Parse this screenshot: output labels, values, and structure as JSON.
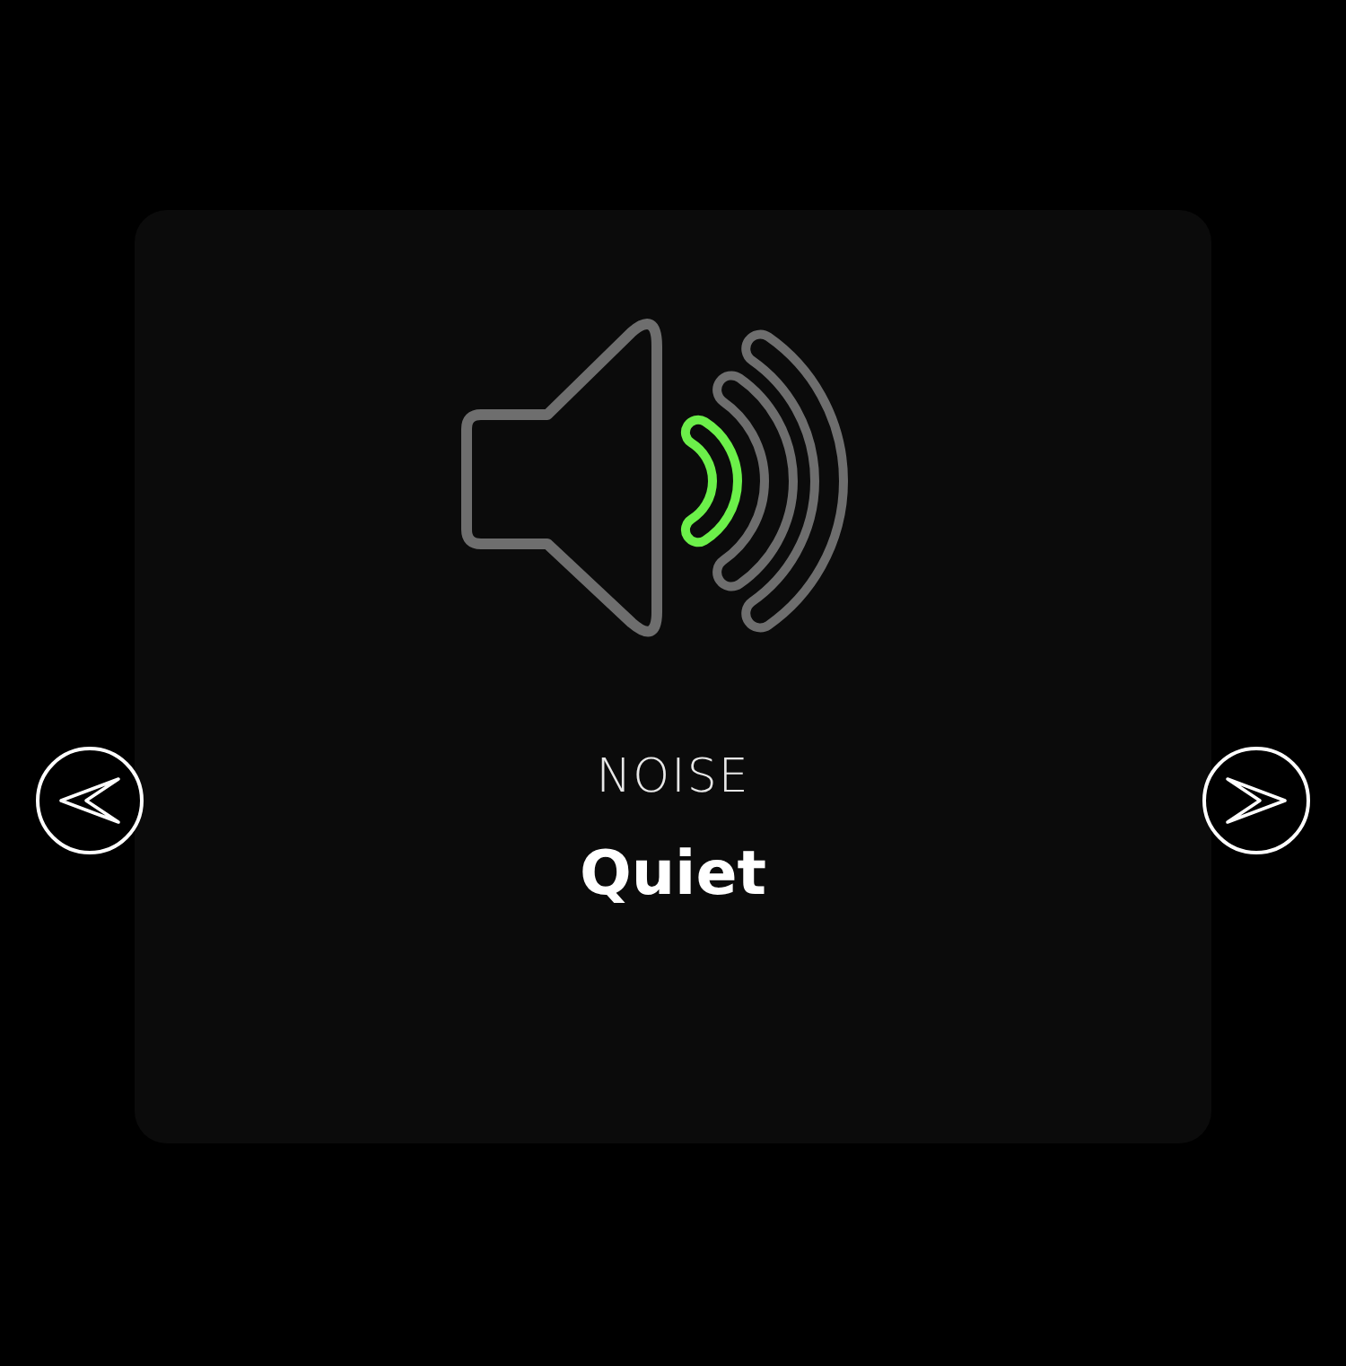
{
  "card": {
    "label": "NOISE",
    "value": "Quiet",
    "waves": [
      {
        "on": true
      },
      {
        "on": false
      },
      {
        "on": false
      }
    ]
  },
  "nav": {
    "previous": {
      "disabled": false
    },
    "next": {
      "disabled": false
    }
  }
}
